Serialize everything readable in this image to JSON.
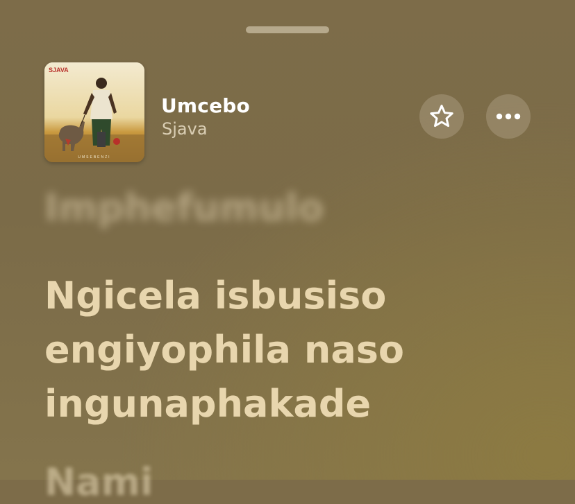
{
  "now_playing": {
    "title": "Umcebo",
    "artist": "Sjava",
    "artwork": {
      "label": "SJAVA",
      "subtitle": "UMSEBENZI"
    }
  },
  "actions": {
    "favorite_icon": "star-icon",
    "more_icon": "ellipsis-icon"
  },
  "lyrics": {
    "previous": "Imphefumulo",
    "current": [
      "Ngicela isbusiso",
      "engiyophila naso",
      "ingunaphakade"
    ],
    "next": "Nami"
  }
}
